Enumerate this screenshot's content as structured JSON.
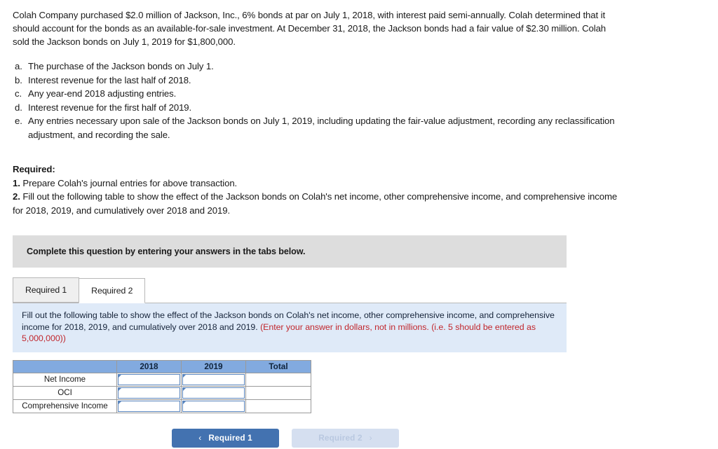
{
  "problem": {
    "intro": "Colah Company purchased $2.0 million of Jackson, Inc., 6% bonds at par on July 1, 2018, with interest paid semi-annually. Colah determined that it should account for the bonds as an available-for-sale investment. At December 31, 2018, the Jackson bonds had a fair value of $2.30 million. Colah sold the Jackson bonds on July 1, 2019 for $1,800,000.",
    "items": [
      {
        "marker": "a.",
        "text": "The purchase of the Jackson bonds on July 1."
      },
      {
        "marker": "b.",
        "text": "Interest revenue for the last half of 2018."
      },
      {
        "marker": "c.",
        "text": "Any year-end 2018 adjusting entries."
      },
      {
        "marker": "d.",
        "text": "Interest revenue for the first half of 2019."
      },
      {
        "marker": "e.",
        "text": "Any entries necessary upon sale of the Jackson bonds on July 1, 2019, including updating the fair-value adjustment, recording any reclassification adjustment, and recording the sale."
      }
    ]
  },
  "required": {
    "heading": "Required:",
    "item1_num": "1.",
    "item1_text": "Prepare Colah's journal entries for above transaction.",
    "item2_num": "2.",
    "item2_text": "Fill out the following table to show the effect of the Jackson bonds on Colah's net income, other comprehensive income, and comprehensive income for 2018, 2019, and cumulatively over 2018 and 2019."
  },
  "complete_bar": {
    "text": "Complete this question by entering your answers in the tabs below."
  },
  "tabs": [
    {
      "label": "Required 1",
      "active": false
    },
    {
      "label": "Required 2",
      "active": true
    }
  ],
  "instruction_panel": {
    "text": "Fill out the following table to show the effect of the Jackson bonds on Colah's net income, other comprehensive income, and comprehensive income for 2018, 2019, and cumulatively over 2018 and 2019.",
    "note": "(Enter your answer in dollars, not in millions. (i.e. 5 should be entered as 5,000,000))",
    "note_color": "#c1272d",
    "background": "#dfeaf8"
  },
  "table": {
    "header_color": "#82aadf",
    "columns": [
      "",
      "2018",
      "2019",
      "Total"
    ],
    "rows": [
      {
        "label": "Net Income",
        "2018": "",
        "2019": "",
        "total": ""
      },
      {
        "label": "OCI",
        "2018": "",
        "2019": "",
        "total": ""
      },
      {
        "label": "Comprehensive Income",
        "2018": "",
        "2019": "",
        "total": ""
      }
    ]
  },
  "nav": {
    "prev": {
      "label": "Required 1",
      "icon": "chevron-left",
      "glyph": "‹",
      "color": "#4372b0",
      "enabled": true
    },
    "next": {
      "label": "Required 2",
      "icon": "chevron-right",
      "glyph": "›",
      "color": "#d5dff0",
      "enabled": false
    }
  }
}
